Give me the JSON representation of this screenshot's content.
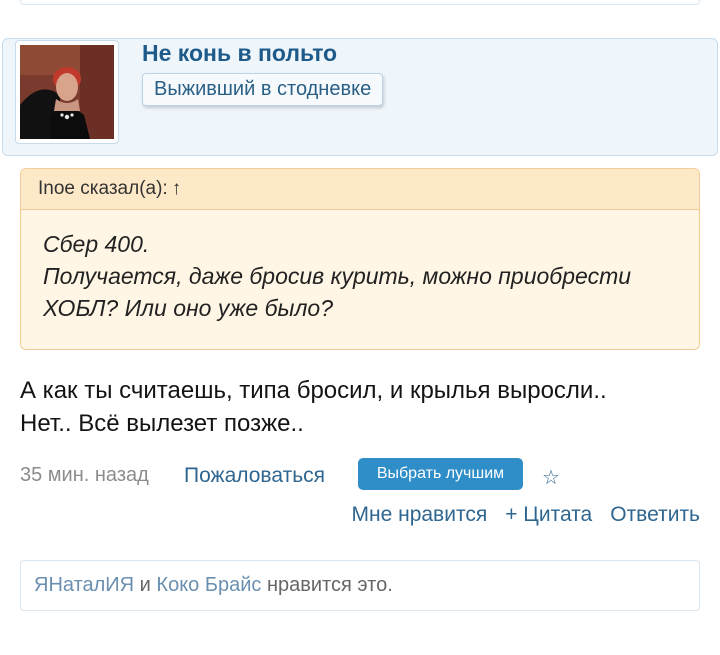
{
  "user": {
    "name": "Не конь в польто",
    "title": "Выживший в стодневке"
  },
  "quote": {
    "attribution": "Inoe сказал(а):",
    "arrow": "↑",
    "lines": [
      "Сбер 400.",
      "Получается, даже бросив курить, можно приобрести ХОБЛ? Или оно уже было?"
    ]
  },
  "post": {
    "lines": [
      "А как ты считаешь, типа бросил, и крылья выросли..",
      "Нет.. Всё вылезет позже.."
    ]
  },
  "meta": {
    "time": "35 мин. назад",
    "report": "Пожаловаться",
    "best": "Выбрать лучшим",
    "star": "☆"
  },
  "actions": {
    "like": "Мне нравится",
    "quote": "+ Цитата",
    "reply": "Ответить"
  },
  "likes": {
    "user1": "ЯНаталИЯ",
    "and": " и ",
    "user2": "Коко Брайс",
    "suffix": " нравится это."
  },
  "colors": {
    "accent": "#2f6690",
    "button": "#2f8ec8",
    "quote_bg": "#fff6e6",
    "card_bg": "#eef5fb"
  }
}
